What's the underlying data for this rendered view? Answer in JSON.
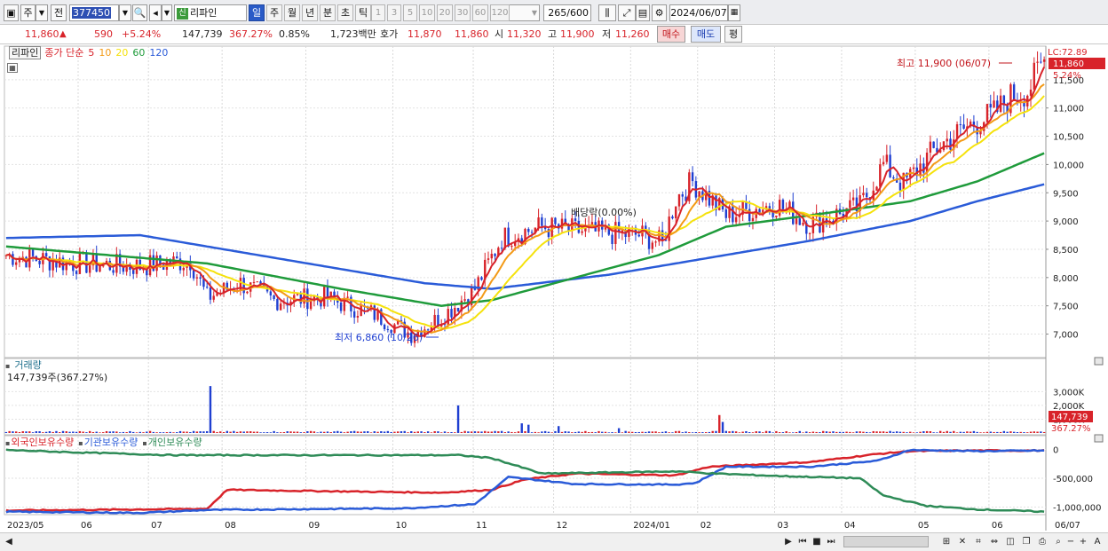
{
  "toolbar": {
    "type_label": "주",
    "type2_label": "전",
    "stock_code": "377450",
    "stock_name": "리파인",
    "shin_badge": "신",
    "periods": [
      "일",
      "주",
      "월",
      "년",
      "분",
      "초",
      "틱"
    ],
    "active_period": "일",
    "intervals": [
      "1",
      "3",
      "5",
      "10",
      "20",
      "30",
      "60",
      "120"
    ],
    "count_value": "265",
    "count_total": "/600",
    "date_value": "2024/06/07"
  },
  "quote": {
    "price": "11,860",
    "arrow": "▲",
    "change": "590",
    "change_pct": "+5.24%",
    "volume": "147,739",
    "volume_ratio": "367.27%",
    "turnover": "0.85%",
    "amount": "1,723백만",
    "hoga_label": "호가",
    "ask": "11,870",
    "bid": "11,860",
    "open_label": "시",
    "open": "11,320",
    "high_label": "고",
    "high": "11,900",
    "low_label": "저",
    "low": "11,260",
    "buy_label": "매수",
    "sell_label": "매도",
    "eval_label": "평"
  },
  "price_panel": {
    "name_tag": "리파인",
    "ma_title": "종가 단순",
    "ma_periods": [
      "5",
      "10",
      "20",
      "60",
      "120"
    ],
    "ma_colors": [
      "#d8232a",
      "#f39a16",
      "#f5e20c",
      "#1f9b3b",
      "#2a5bd8"
    ],
    "lc_label": "LC:72.89",
    "last_price": "11,860",
    "last_pct": "5.24%",
    "high_note": "최고 11,900 (06/07)",
    "low_note": "최저 6,860 (10/26)",
    "dividend_note": "배당락(0.00%)"
  },
  "volume_panel": {
    "title": "거래량",
    "subtitle": "147,739주(367.27%)",
    "last_volume": "147,739",
    "last_ratio": "367.27%"
  },
  "holding_panel": {
    "series_labels": [
      "외국인보유수량",
      "기관보유수량",
      "개인보유수량"
    ],
    "series_colors": [
      "#d8232a",
      "#2a5bd8",
      "#2e8b57"
    ]
  },
  "chart_data": [
    {
      "type": "candlestick",
      "title": "리파인",
      "ylim": [
        6600,
        12000
      ],
      "y_ticks": [
        "7,000",
        "7,500",
        "8,000",
        "8,500",
        "9,000",
        "9,500",
        "10,000",
        "10,500",
        "11,000",
        "11,500"
      ],
      "x_ticks": [
        "2023/05",
        "06",
        "07",
        "08",
        "09",
        "10",
        "11",
        "12",
        "2024/01",
        "02",
        "03",
        "04",
        "05",
        "06"
      ],
      "x_end_label": "06/07",
      "close_anchors": [
        [
          0,
          8400
        ],
        [
          20,
          8250
        ],
        [
          40,
          8200
        ],
        [
          55,
          8300
        ],
        [
          60,
          7650
        ],
        [
          70,
          7900
        ],
        [
          80,
          7600
        ],
        [
          95,
          7650
        ],
        [
          110,
          7350
        ],
        [
          121,
          7000
        ],
        [
          130,
          7300
        ],
        [
          140,
          7800
        ],
        [
          148,
          8700
        ],
        [
          160,
          8900
        ],
        [
          175,
          8800
        ],
        [
          190,
          8750
        ],
        [
          196,
          8600
        ],
        [
          200,
          9400
        ],
        [
          205,
          9700
        ],
        [
          215,
          9100
        ],
        [
          230,
          9300
        ],
        [
          240,
          8950
        ],
        [
          255,
          9250
        ],
        [
          262,
          10000
        ],
        [
          268,
          9650
        ],
        [
          278,
          10300
        ],
        [
          288,
          10700
        ],
        [
          295,
          10900
        ],
        [
          300,
          11200
        ],
        [
          305,
          11300
        ],
        [
          310,
          11860
        ]
      ],
      "ma60_anchors": [
        [
          0,
          8550
        ],
        [
          60,
          8250
        ],
        [
          100,
          7800
        ],
        [
          130,
          7500
        ],
        [
          145,
          7600
        ],
        [
          170,
          8000
        ],
        [
          195,
          8400
        ],
        [
          215,
          8900
        ],
        [
          240,
          9100
        ],
        [
          270,
          9350
        ],
        [
          290,
          9700
        ],
        [
          310,
          10200
        ]
      ],
      "ma120_anchors": [
        [
          0,
          8700
        ],
        [
          40,
          8750
        ],
        [
          70,
          8450
        ],
        [
          100,
          8150
        ],
        [
          125,
          7900
        ],
        [
          145,
          7800
        ],
        [
          180,
          8050
        ],
        [
          210,
          8350
        ],
        [
          240,
          8650
        ],
        [
          270,
          9000
        ],
        [
          290,
          9350
        ],
        [
          310,
          9650
        ]
      ]
    },
    {
      "type": "bar",
      "title": "거래량",
      "ylim": [
        0,
        4500000
      ],
      "y_ticks": [
        "1,000K",
        "2,000K",
        "3,000K"
      ],
      "spikes": [
        [
          61,
          3400000
        ],
        [
          135,
          2000000
        ],
        [
          154,
          700000
        ],
        [
          156,
          600000
        ],
        [
          165,
          500000
        ],
        [
          183,
          350000
        ],
        [
          213,
          1300000
        ],
        [
          214,
          800000
        ]
      ]
    },
    {
      "type": "line",
      "title": "보유수량",
      "ylim": [
        -1100000,
        100000
      ],
      "y_ticks": [
        "0",
        "-500,000",
        "-1,000,000"
      ],
      "series": [
        {
          "name": "외국인보유수량",
          "anchors": [
            [
              0,
              -1060000
            ],
            [
              60,
              -1030000
            ],
            [
              66,
              -700000
            ],
            [
              90,
              -720000
            ],
            [
              130,
              -750000
            ],
            [
              145,
              -700000
            ],
            [
              155,
              -520000
            ],
            [
              170,
              -420000
            ],
            [
              200,
              -450000
            ],
            [
              210,
              -300000
            ],
            [
              240,
              -220000
            ],
            [
              260,
              -80000
            ],
            [
              270,
              -30000
            ],
            [
              290,
              -20000
            ],
            [
              310,
              -20000
            ]
          ]
        },
        {
          "name": "기관보유수량",
          "anchors": [
            [
              0,
              -1080000
            ],
            [
              40,
              -1100000
            ],
            [
              60,
              -1050000
            ],
            [
              120,
              -1020000
            ],
            [
              140,
              -950000
            ],
            [
              150,
              -480000
            ],
            [
              170,
              -600000
            ],
            [
              200,
              -610000
            ],
            [
              206,
              -580000
            ],
            [
              215,
              -300000
            ],
            [
              240,
              -300000
            ],
            [
              260,
              -200000
            ],
            [
              270,
              -10000
            ],
            [
              290,
              -30000
            ],
            [
              310,
              -20000
            ]
          ]
        },
        {
          "name": "개인보유수량",
          "anchors": [
            [
              0,
              -10000
            ],
            [
              20,
              -50000
            ],
            [
              50,
              -100000
            ],
            [
              100,
              -100000
            ],
            [
              135,
              -100000
            ],
            [
              145,
              -150000
            ],
            [
              160,
              -420000
            ],
            [
              200,
              -380000
            ],
            [
              212,
              -420000
            ],
            [
              230,
              -460000
            ],
            [
              255,
              -500000
            ],
            [
              262,
              -800000
            ],
            [
              275,
              -980000
            ],
            [
              290,
              -1040000
            ],
            [
              310,
              -1080000
            ]
          ]
        }
      ]
    }
  ]
}
